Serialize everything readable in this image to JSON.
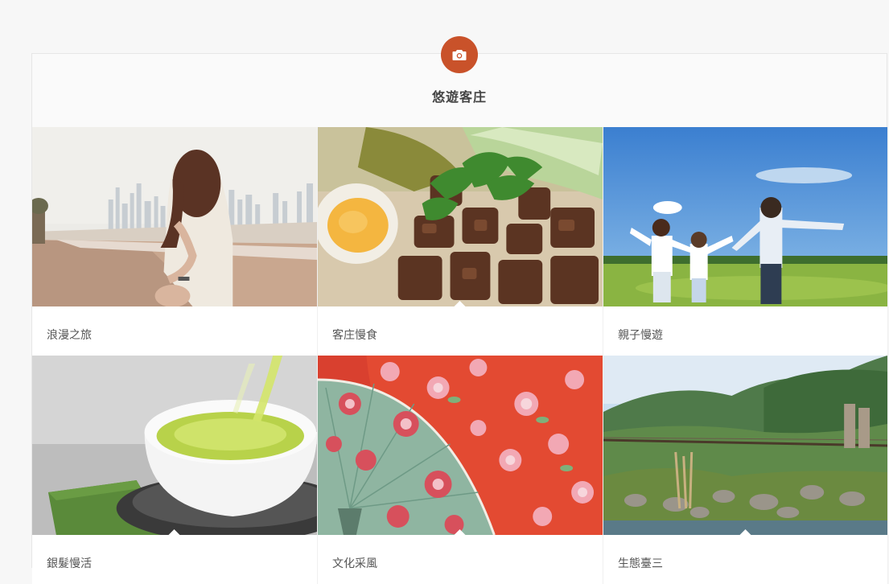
{
  "section": {
    "icon": "camera-icon",
    "title": "悠遊客庄",
    "accent_color": "#c9522a"
  },
  "cards": [
    {
      "label": "浪漫之旅",
      "image": "couple-holding-hands-city-skyline-photo"
    },
    {
      "label": "客庄慢食",
      "image": "braised-pork-rice-with-egg-photo"
    },
    {
      "label": "親子慢遊",
      "image": "family-on-grassland-photo"
    },
    {
      "label": "銀髮慢活",
      "image": "green-tea-cup-photo"
    },
    {
      "label": "文化采風",
      "image": "hakka-floral-paper-umbrellas-photo"
    },
    {
      "label": "生態臺三",
      "image": "suspension-bridge-river-mountains-photo"
    }
  ]
}
